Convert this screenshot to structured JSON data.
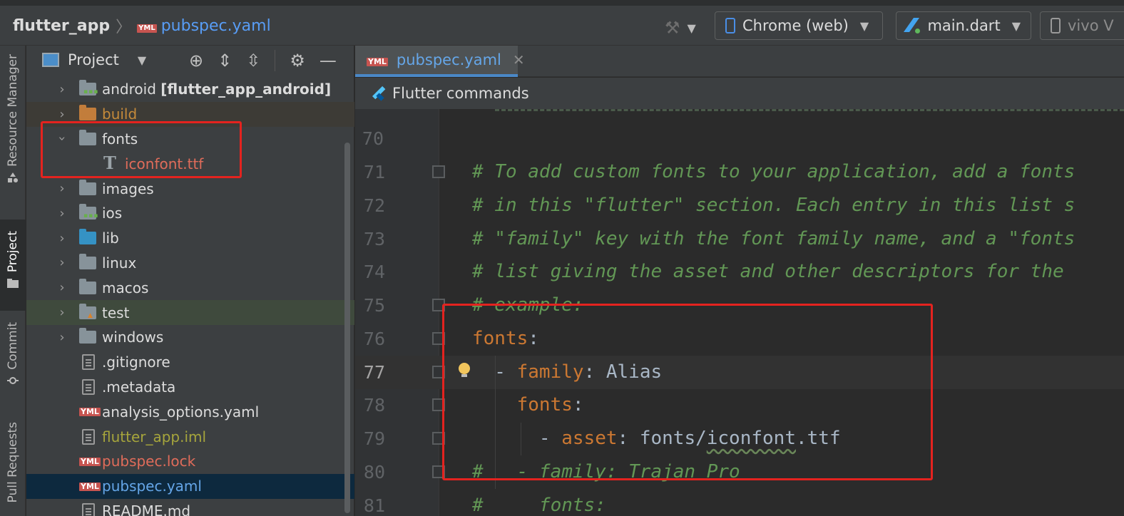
{
  "breadcrumb": {
    "root": "flutter_app",
    "file": "pubspec.yaml",
    "file_badge": "YML"
  },
  "toolbar": {
    "device": "Chrome (web)",
    "config": "main.dart",
    "second_device": "vivo V"
  },
  "side_strip": [
    {
      "label": "Resource Manager"
    },
    {
      "label": "Project"
    },
    {
      "label": "Commit"
    },
    {
      "label": "Pull Requests"
    }
  ],
  "project_panel": {
    "title": "Project",
    "tree": [
      {
        "name": "android",
        "suffix": "[flutter_app_android]",
        "type": "folder-module",
        "expanded": false
      },
      {
        "name": "build",
        "type": "folder-excluded",
        "expanded": false
      },
      {
        "name": "fonts",
        "type": "folder",
        "expanded": true
      },
      {
        "name": "iconfont.ttf",
        "type": "font-file"
      },
      {
        "name": "images",
        "type": "folder",
        "expanded": false
      },
      {
        "name": "ios",
        "type": "folder-module",
        "expanded": false
      },
      {
        "name": "lib",
        "type": "folder-source",
        "expanded": false
      },
      {
        "name": "linux",
        "type": "folder",
        "expanded": false
      },
      {
        "name": "macos",
        "type": "folder",
        "expanded": false
      },
      {
        "name": "test",
        "type": "folder-test",
        "expanded": false
      },
      {
        "name": "windows",
        "type": "folder",
        "expanded": false
      },
      {
        "name": ".gitignore",
        "type": "file"
      },
      {
        "name": ".metadata",
        "type": "file"
      },
      {
        "name": "analysis_options.yaml",
        "type": "yaml"
      },
      {
        "name": "flutter_app.iml",
        "type": "iml"
      },
      {
        "name": "pubspec.lock",
        "type": "yaml"
      },
      {
        "name": "pubspec.yaml",
        "type": "yaml"
      },
      {
        "name": "README.md",
        "type": "file"
      }
    ]
  },
  "editor": {
    "tab_label": "pubspec.yaml",
    "command_bar": "Flutter commands",
    "lines": [
      {
        "num": "70",
        "text": ""
      },
      {
        "num": "71",
        "text": "# To add custom fonts to your application, add a fonts"
      },
      {
        "num": "72",
        "text": "# in this \"flutter\" section. Each entry in this list s"
      },
      {
        "num": "73",
        "text": "# \"family\" key with the font family name, and a \"fonts"
      },
      {
        "num": "74",
        "text": "# list giving the asset and other descriptors for the"
      },
      {
        "num": "75",
        "text": "# example:"
      },
      {
        "num": "76",
        "key": "fonts",
        "colon": ":"
      },
      {
        "num": "77",
        "dash": "  - ",
        "key": "family",
        "colon": ": ",
        "value": "Alias"
      },
      {
        "num": "78",
        "indent": "    ",
        "key": "fonts",
        "colon": ":"
      },
      {
        "num": "79",
        "dash": "      - ",
        "key": "asset",
        "colon": ": ",
        "value_pre": "fonts/",
        "value_squig": "iconfont",
        "value_post": ".ttf"
      },
      {
        "num": "80",
        "text": "#   - family: Trajan Pro"
      },
      {
        "num": "81",
        "text": "#     fonts:"
      }
    ]
  },
  "annotation_color": "#e4231f"
}
